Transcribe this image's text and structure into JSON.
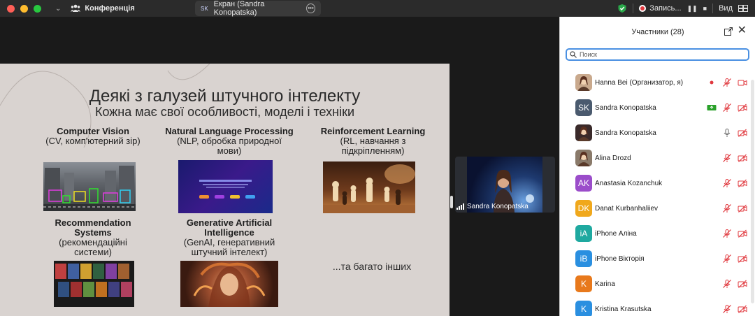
{
  "titlebar": {
    "meeting_title": "Конференція",
    "share_tab_badge": "SK",
    "share_tab_label": "Екран (Sandra Konopatska)",
    "recording_label": "Запись...",
    "view_label": "Вид"
  },
  "slide": {
    "title": "Деякі з галузей штучного інтелекту",
    "subtitle": "Кожна має свої особливості, моделі і техніки",
    "items": [
      {
        "heading": "Computer Vision",
        "desc": "(CV, комп'ютерний зір)"
      },
      {
        "heading": "Natural Language Processing",
        "desc": "(NLP, обробка природної мови)"
      },
      {
        "heading": "Reinforcement Learning",
        "desc": "(RL, навчання з підкріпленням)"
      },
      {
        "heading": "Recommendation Systems",
        "desc": "(рекомендаційні системи)"
      },
      {
        "heading": "Generative Artificial Intelligence",
        "desc": "(GenAI, генеративний штучний інтелект)"
      }
    ],
    "more": "...та багато інших"
  },
  "video": {
    "name": "Sandra Konopatska"
  },
  "panel": {
    "title": "Участники (28)",
    "search_placeholder": "Поиск",
    "participants": [
      {
        "initials": "",
        "name": "Hanna Bei (Организатор, я)",
        "avatar_color": "#c9a98d"
      },
      {
        "initials": "SK",
        "name": "Sandra Konopatska",
        "avatar_color": "#4a5a6e"
      },
      {
        "initials": "",
        "name": "Sandra Konopatska",
        "avatar_color": "#3a2a2a"
      },
      {
        "initials": "",
        "name": "Alina Drozd",
        "avatar_color": "#8a7a6a"
      },
      {
        "initials": "AK",
        "name": "Anastasia Kozanchuk",
        "avatar_color": "#9b4dca"
      },
      {
        "initials": "DK",
        "name": "Danat Kurbanhaliiev",
        "avatar_color": "#f0a81c"
      },
      {
        "initials": "iA",
        "name": "iPhone Аліна",
        "avatar_color": "#1fa9a0"
      },
      {
        "initials": "iB",
        "name": "iPhone Вікторія",
        "avatar_color": "#2a8fe0"
      },
      {
        "initials": "K",
        "name": "Karina",
        "avatar_color": "#e8791c"
      },
      {
        "initials": "K",
        "name": "Kristina Krasutska",
        "avatar_color": "#2a8fe0"
      }
    ]
  },
  "colors": {
    "accent": "#4a90e2",
    "mute_red": "#e0383e",
    "share_green": "#2aa12a"
  }
}
